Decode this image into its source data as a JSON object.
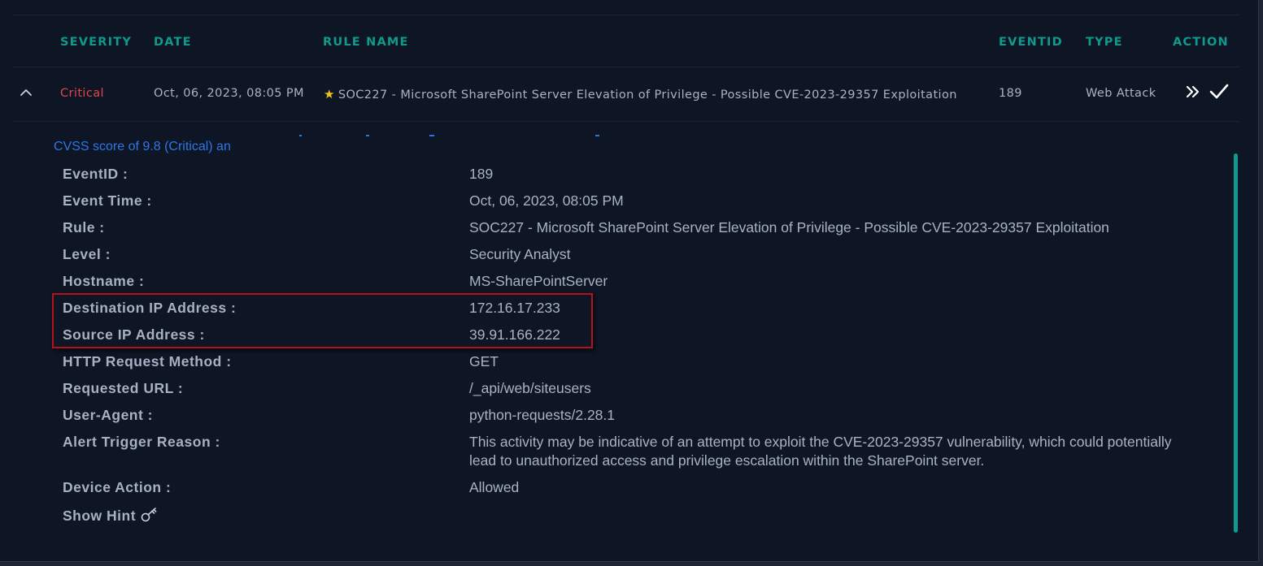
{
  "table": {
    "headers": {
      "severity": "SEVERITY",
      "date": "DATE",
      "rule_name": "RULE NAME",
      "eventid": "EVENTID",
      "type": "TYPE",
      "action": "ACTION"
    },
    "row": {
      "severity": "Critical",
      "date": "Oct, 06, 2023, 08:05 PM",
      "rule_name": "SOC227 - Microsoft SharePoint Server Elevation of Privilege - Possible CVE-2023-29357 Exploitation",
      "eventid": "189",
      "type": "Web Attack"
    }
  },
  "details": {
    "cvss_text": "CVSS score of 9.8 (Critical) an",
    "fields": [
      {
        "label": "EventID :",
        "value": "189"
      },
      {
        "label": "Event Time :",
        "value": "Oct, 06, 2023, 08:05 PM"
      },
      {
        "label": "Rule :",
        "value": "SOC227 - Microsoft SharePoint Server Elevation of Privilege - Possible CVE-2023-29357 Exploitation"
      },
      {
        "label": "Level :",
        "value": "Security Analyst"
      },
      {
        "label": "Hostname :",
        "value": "MS-SharePointServer"
      },
      {
        "label": "Destination IP Address :",
        "value": "172.16.17.233"
      },
      {
        "label": "Source IP Address :",
        "value": "39.91.166.222"
      },
      {
        "label": "HTTP Request Method :",
        "value": "GET"
      },
      {
        "label": "Requested URL :",
        "value": "/_api/web/siteusers"
      },
      {
        "label": "User-Agent :",
        "value": "python-requests/2.28.1"
      },
      {
        "label": "Alert Trigger Reason :",
        "value": "This activity may be indicative of an attempt to exploit the CVE-2023-29357 vulnerability, which could potentially lead to unauthorized access and privilege escalation within the SharePoint server."
      },
      {
        "label": "Device Action :",
        "value": "Allowed"
      }
    ],
    "show_hint": "Show Hint"
  },
  "colors": {
    "background": "#0e1524",
    "accent_teal": "#109a8d",
    "critical_red": "#e0474a",
    "link_blue": "#2b78e4",
    "highlight_red": "#b3141c",
    "star_yellow": "#f3c518"
  },
  "icons": {
    "collapse": "chevron-up-icon",
    "escalate": "double-chevron-right-icon",
    "close": "checkmark-icon",
    "favorite": "star-icon",
    "hint": "key-icon"
  }
}
